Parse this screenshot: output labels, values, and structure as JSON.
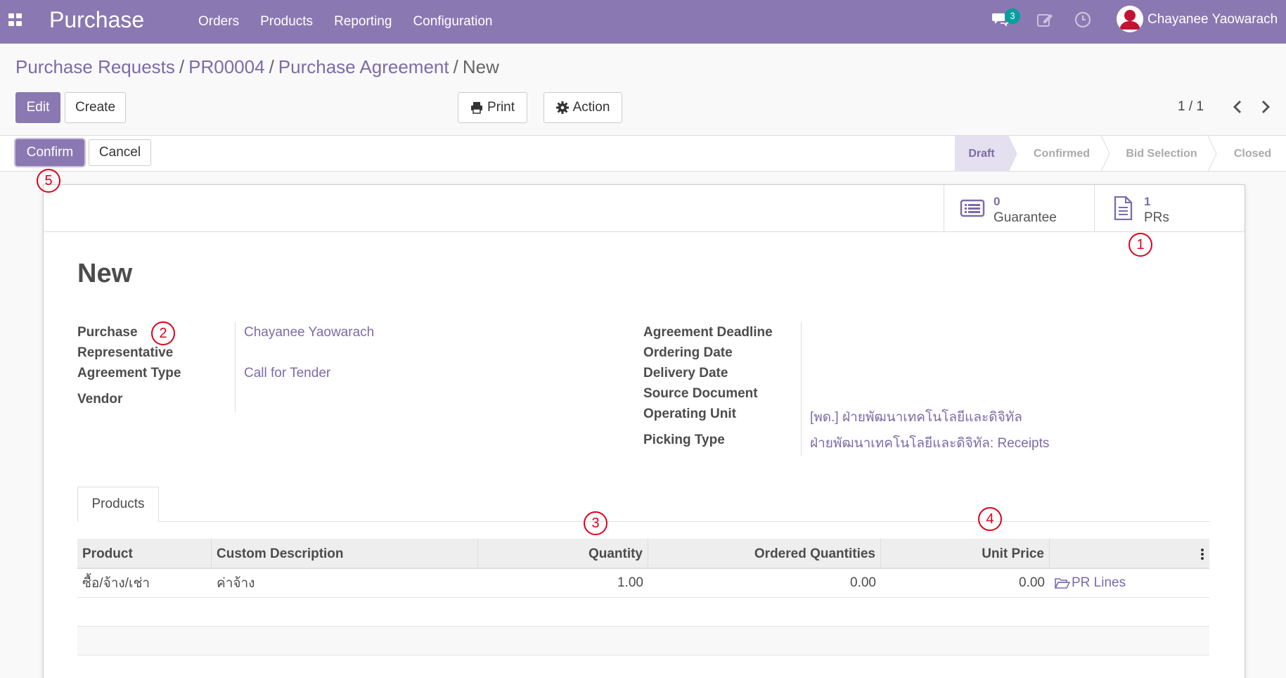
{
  "navbar": {
    "app_title": "Purchase",
    "menu": [
      "Orders",
      "Products",
      "Reporting",
      "Configuration"
    ],
    "chat_badge": "3",
    "user_name": "Chayanee Yaowarach",
    "icons": [
      "apps-icon",
      "chat-icon",
      "edit-icon",
      "clock-icon",
      "avatar"
    ]
  },
  "breadcrumb": {
    "items": [
      "Purchase Requests",
      "PR00004",
      "Purchase Agreement"
    ],
    "separator": "/",
    "current": "New"
  },
  "toolbar": {
    "edit": "Edit",
    "create": "Create",
    "print": "Print",
    "action": "Action",
    "pager": "1 / 1"
  },
  "statusbar": {
    "confirm": "Confirm",
    "cancel": "Cancel",
    "stages": [
      "Draft",
      "Confirmed",
      "Bid Selection",
      "Closed"
    ],
    "active_stage": "Draft"
  },
  "smart_buttons": [
    {
      "value": "0",
      "label": "Guarantee",
      "icon": "list-icon"
    },
    {
      "value": "1",
      "label": "PRs",
      "icon": "document-icon"
    }
  ],
  "form": {
    "title": "New",
    "left": {
      "purchase_rep_label_1": "Purchase",
      "purchase_rep_label_2": "Representative",
      "purchase_rep_value": "Chayanee Yaowarach",
      "agreement_type_label": "Agreement Type",
      "agreement_type_value": "Call for Tender",
      "vendor_label": "Vendor"
    },
    "right": {
      "deadline_label": "Agreement Deadline",
      "ordering_date_label": "Ordering Date",
      "delivery_date_label": "Delivery Date",
      "source_doc_label": "Source Document",
      "operating_unit_label": "Operating Unit",
      "operating_unit_value": "[พด.] ฝ่ายพัฒนาเทคโนโลยีและดิจิทัล",
      "picking_type_label": "Picking Type",
      "picking_type_value": "ฝ่ายพัฒนาเทคโนโลยีและดิจิทัล: Receipts"
    }
  },
  "tabs": [
    "Products"
  ],
  "table": {
    "columns": [
      "Product",
      "Custom Description",
      "Quantity",
      "Ordered Quantities",
      "Unit Price"
    ],
    "rows": [
      {
        "product": "ซื้อ/จ้าง/เช่า",
        "description": "ค่าจ้าง",
        "quantity": "1.00",
        "ordered": "0.00",
        "unit_price": "0.00",
        "link": "PR Lines"
      }
    ]
  },
  "annotations": [
    "1",
    "2",
    "3",
    "4",
    "5"
  ],
  "colors": {
    "navbar": "#8a78b2",
    "accent": "#7c6ba8",
    "badge": "#00a09d",
    "annotation": "#e0001a"
  }
}
